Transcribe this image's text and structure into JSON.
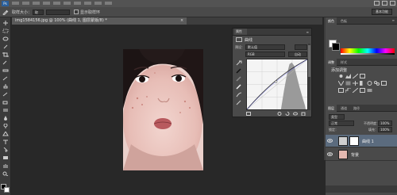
{
  "app": {
    "name": "Ps"
  },
  "options_bar": {
    "sample_size_label": "取样大小：",
    "sample_size_value": "取",
    "show_ring_label": "显示取样环",
    "workspace": "基本功能"
  },
  "document": {
    "tab_title": "img1584156.jpg @ 100% (曲线 1, 图层蒙版/8) *",
    "close": "×"
  },
  "curves_panel": {
    "tab": "属性",
    "title": "曲线",
    "preset_label": "预设：",
    "preset_value": "默认值",
    "preset_button": "",
    "channel_label": "",
    "channel_value": "RGB",
    "auto_button": "自动",
    "menu_glyph": "≡",
    "curve": {
      "points": [
        [
          0,
          0
        ],
        [
          123,
          142
        ],
        [
          255,
          255
        ]
      ]
    },
    "histogram_color": "#9a9a9a"
  },
  "right_panels": {
    "color_tabs": [
      "颜色",
      "色板"
    ],
    "adjust_tabs": [
      "调整",
      "样式"
    ],
    "adjust_label": "添加调整",
    "menu_glyph": "≡",
    "layers_tabs": [
      "图层",
      "通道",
      "路径"
    ],
    "kind": "类型",
    "blend_mode": "正常",
    "opacity_label": "不透明度：",
    "opacity_value": "100%",
    "lock_label": "锁定：",
    "fill_label": "填充：",
    "fill_value": "100%"
  },
  "layers": [
    {
      "name": "曲线 1",
      "selected": true,
      "thumb": "adjustment"
    },
    {
      "name": "背景",
      "selected": false,
      "thumb": "photo"
    }
  ],
  "colors": {
    "accent_selection": "#5b6b7e",
    "panel_bg": "#4a4a4a",
    "canvas_bg": "#282828"
  }
}
